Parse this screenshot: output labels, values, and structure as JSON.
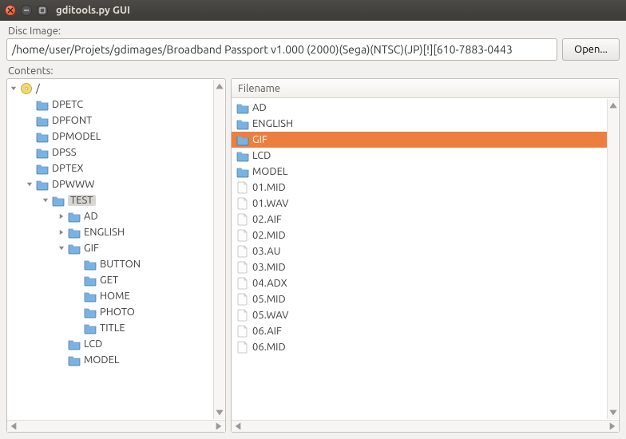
{
  "window": {
    "title": "gditools.py GUI"
  },
  "disc_image": {
    "label": "Disc Image:",
    "path": "/home/user/Projets/gdimages/Broadband Passport v1.000 (2000)(Sega)(NTSC)(JP)[!][610-7883-0443",
    "open_button": "Open..."
  },
  "contents": {
    "label": "Contents:"
  },
  "tree": [
    {
      "depth": 0,
      "expander": "down",
      "icon": "disc",
      "label": "/",
      "selected": false
    },
    {
      "depth": 1,
      "expander": "none",
      "icon": "folder",
      "label": "DPETC"
    },
    {
      "depth": 1,
      "expander": "none",
      "icon": "folder",
      "label": "DPFONT"
    },
    {
      "depth": 1,
      "expander": "none",
      "icon": "folder",
      "label": "DPMODEL"
    },
    {
      "depth": 1,
      "expander": "none",
      "icon": "folder",
      "label": "DPSS"
    },
    {
      "depth": 1,
      "expander": "none",
      "icon": "folder",
      "label": "DPTEX"
    },
    {
      "depth": 1,
      "expander": "down",
      "icon": "folder",
      "label": "DPWWW"
    },
    {
      "depth": 2,
      "expander": "down",
      "icon": "folder",
      "label": "TEST",
      "selected": true
    },
    {
      "depth": 3,
      "expander": "right",
      "icon": "folder",
      "label": "AD"
    },
    {
      "depth": 3,
      "expander": "right",
      "icon": "folder",
      "label": "ENGLISH"
    },
    {
      "depth": 3,
      "expander": "down",
      "icon": "folder",
      "label": "GIF"
    },
    {
      "depth": 4,
      "expander": "none",
      "icon": "folder",
      "label": "BUTTON"
    },
    {
      "depth": 4,
      "expander": "none",
      "icon": "folder",
      "label": "GET"
    },
    {
      "depth": 4,
      "expander": "none",
      "icon": "folder",
      "label": "HOME"
    },
    {
      "depth": 4,
      "expander": "none",
      "icon": "folder",
      "label": "PHOTO"
    },
    {
      "depth": 4,
      "expander": "none",
      "icon": "folder",
      "label": "TITLE"
    },
    {
      "depth": 3,
      "expander": "none",
      "icon": "folder",
      "label": "LCD"
    },
    {
      "depth": 3,
      "expander": "none",
      "icon": "folder",
      "label": "MODEL"
    }
  ],
  "filelist": {
    "header": "Filename",
    "rows": [
      {
        "icon": "folder",
        "label": "AD",
        "selected": false
      },
      {
        "icon": "folder",
        "label": "ENGLISH",
        "selected": false
      },
      {
        "icon": "folder",
        "label": "GIF",
        "selected": true
      },
      {
        "icon": "folder",
        "label": "LCD",
        "selected": false
      },
      {
        "icon": "folder",
        "label": "MODEL",
        "selected": false
      },
      {
        "icon": "file",
        "label": "01.MID",
        "selected": false
      },
      {
        "icon": "file",
        "label": "01.WAV",
        "selected": false
      },
      {
        "icon": "file",
        "label": "02.AIF",
        "selected": false
      },
      {
        "icon": "file",
        "label": "02.MID",
        "selected": false
      },
      {
        "icon": "file",
        "label": "03.AU",
        "selected": false
      },
      {
        "icon": "file",
        "label": "03.MID",
        "selected": false
      },
      {
        "icon": "file",
        "label": "04.ADX",
        "selected": false
      },
      {
        "icon": "file",
        "label": "05.MID",
        "selected": false
      },
      {
        "icon": "file",
        "label": "05.WAV",
        "selected": false
      },
      {
        "icon": "file",
        "label": "06.AIF",
        "selected": false
      },
      {
        "icon": "file",
        "label": "06.MID",
        "selected": false
      }
    ]
  }
}
